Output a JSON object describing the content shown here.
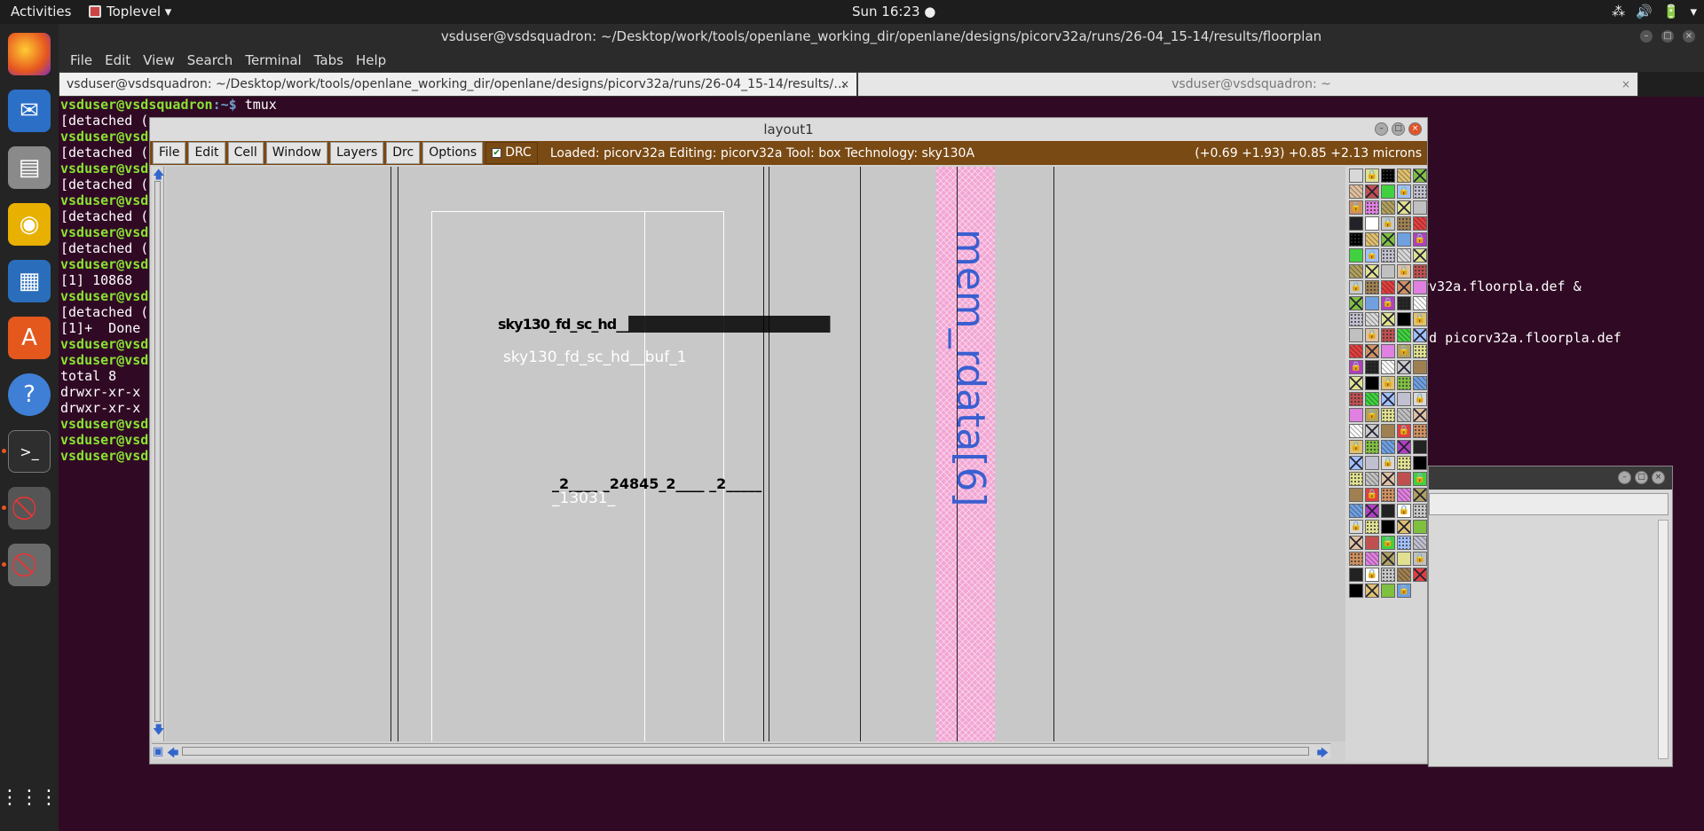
{
  "topbar": {
    "activities": "Activities",
    "app_name": "Toplevel ▾",
    "clock": "Sun 16:23 ●",
    "tray": [
      "⁂",
      "🔊",
      "🔋",
      "▾"
    ]
  },
  "dock": {
    "items": [
      "firefox-icon",
      "thunderbird-icon",
      "files-icon",
      "rhythmbox-icon",
      "writer-icon",
      "software-icon",
      "help-icon",
      "terminal-icon",
      "blocked-app-icon",
      "blocked-app-icon-2",
      "app-grid-icon"
    ]
  },
  "terminal": {
    "title": "vsduser@vsdsquadron: ~/Desktop/work/tools/openlane_working_dir/openlane/designs/picorv32a/runs/26-04_15-14/results/floorplan",
    "menu": [
      "File",
      "Edit",
      "View",
      "Search",
      "Terminal",
      "Tabs",
      "Help"
    ],
    "tab1": "vsduser@vsdsquadron: ~/Desktop/work/tools/openlane_working_dir/openlane/designs/picorv32a/runs/26-04_15-14/results/…",
    "tab2": "vsduser@vsdsquadron: ~",
    "tab_close": "×",
    "lines": [
      {
        "user": "vsduser@vsdsquadron",
        "path": ":~$",
        "text": " tmux"
      },
      {
        "user": "",
        "path": "",
        "text": "[detached ("
      },
      {
        "user": "vsduser@vsds",
        "path": "",
        "text": ""
      },
      {
        "user": "",
        "path": "",
        "text": "[detached ("
      },
      {
        "user": "vsduser@vsds",
        "path": "",
        "text": ""
      },
      {
        "user": "",
        "path": "",
        "text": "[detached ("
      },
      {
        "user": "vsduser@vsds",
        "path": "",
        "text": ""
      },
      {
        "user": "",
        "path": "",
        "text": "[detached ("
      },
      {
        "user": "vsduser@vsds",
        "path": "",
        "text": ""
      },
      {
        "user": "",
        "path": "",
        "text": "[detached ("
      },
      {
        "user": "vsduser@vsds",
        "path": "",
        "text": ""
      },
      {
        "user": "",
        "path": "",
        "text": "[1] 10868"
      },
      {
        "user": "vsduser@vsds",
        "path": "",
        "text": ""
      },
      {
        "user": "",
        "path": "",
        "text": "[detached ("
      },
      {
        "user": "",
        "path": "",
        "text": "[1]+  Done"
      },
      {
        "user": "vsduser@vsds",
        "path": "",
        "text": ""
      },
      {
        "user": "vsduser@vsds",
        "path": "",
        "text": ""
      },
      {
        "user": "",
        "path": "",
        "text": "total 8"
      },
      {
        "user": "",
        "path": "",
        "text": "drwxr-xr-x"
      },
      {
        "user": "",
        "path": "",
        "text": "drwxr-xr-x"
      },
      {
        "user": "vsduser@vsds",
        "path": "",
        "text": ""
      },
      {
        "user": "vsduser@vsds",
        "path": "",
        "text": ""
      },
      {
        "user": "vsduser@vsds",
        "path": "",
        "text": ""
      }
    ],
    "right_line_1": "rv32a.floorpla.def &",
    "right_line_2": "ad picorv32a.floorpla.def"
  },
  "layout": {
    "title": "layout1",
    "menu": [
      "File",
      "Edit",
      "Cell",
      "Window",
      "Layers",
      "Drc",
      "Options"
    ],
    "drc_label": "DRC",
    "status": "Loaded: picorv32a Editing: picorv32a Tool: box  Technology: sky130A",
    "coords": "(+0.69 +1.93) +0.85 +2.13 microns",
    "canvas": {
      "overlap_label": "sky130_fd_sc_hd__",
      "cell_label": "sky130_fd_sc_hd__buf_1",
      "net_overlap_label": "_2____ _24845_2____ _2_____",
      "net_label": "_13031_",
      "pin_label": "mem_rdata[6]"
    }
  },
  "colors": {
    "terminal_bg": "#300a24",
    "magic_menubar": "#7a4a14",
    "canvas_bg": "#c8c8c8",
    "pin_stripe": "#f2a6d4",
    "pin_label": "#3a5fd0"
  }
}
